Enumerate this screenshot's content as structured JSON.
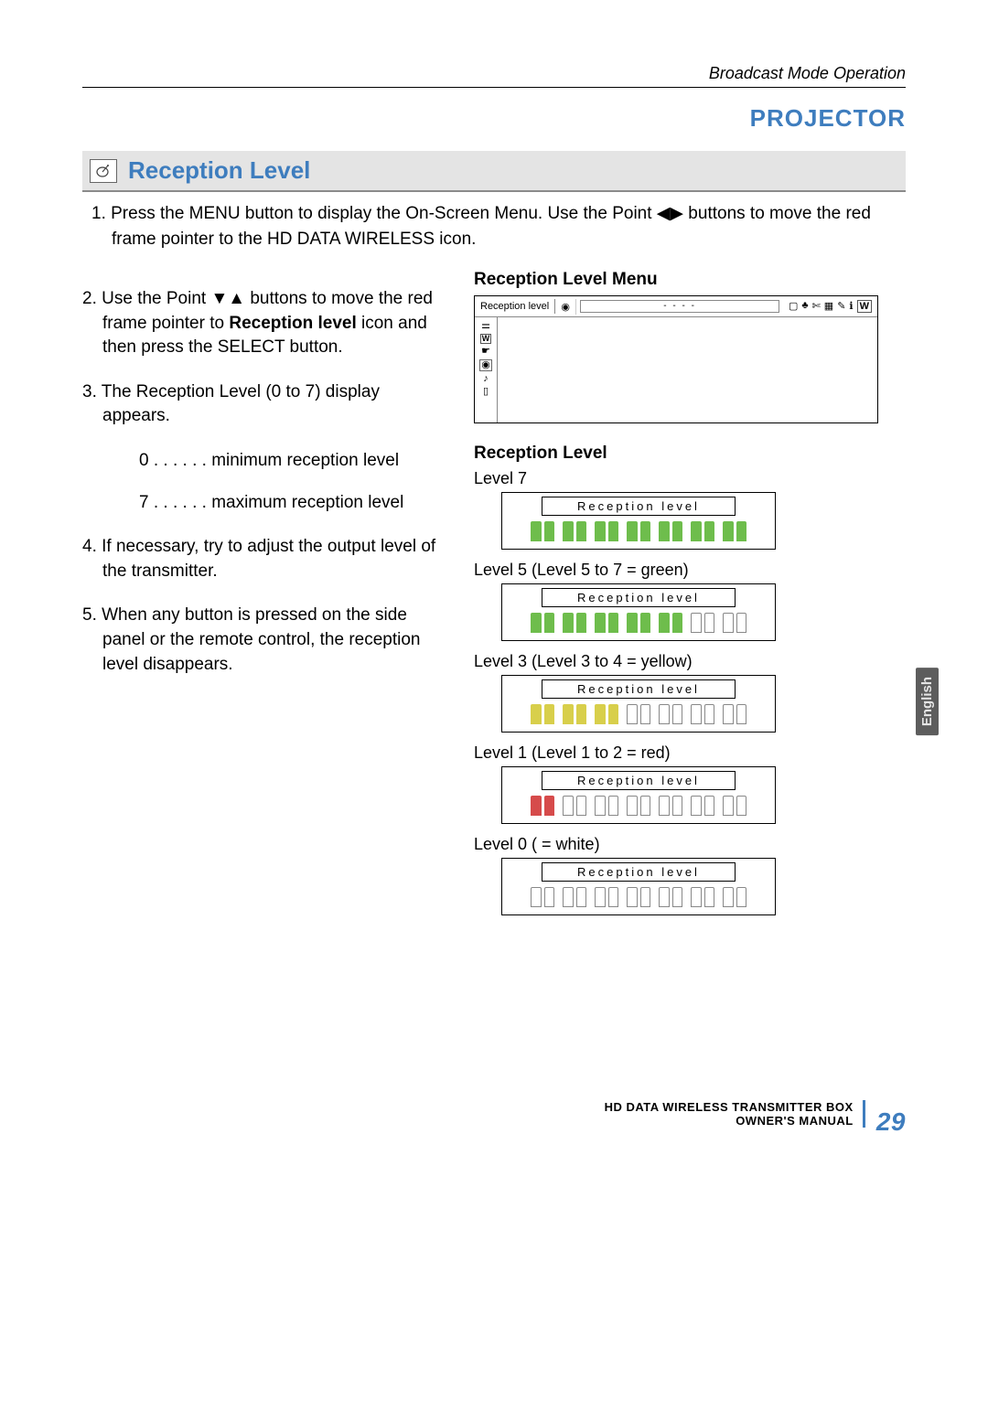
{
  "running_head": "Broadcast Mode Operation",
  "projector": "PROJECTOR",
  "section_title": "Reception Level",
  "intro_step": "1.  Press the MENU button to display the On-Screen Menu. Use the Point ◀▶ buttons to move the red frame pointer to the HD DATA WIRELESS icon.",
  "steps": {
    "s2a": "2. Use the Point ▼▲ buttons to move the red frame pointer to ",
    "s2b": "Reception level",
    "s2c": " icon and then press the SELECT button.",
    "s3": "3. The Reception Level (0 to 7) display appears.",
    "s3_0": "0 . . . . . . minimum reception level",
    "s3_7": "7 . . . . . . maximum reception level",
    "s4": "4. If necessary, try to adjust the output level of the transmitter.",
    "s5": "5. When any button is pressed on the side panel or the remote control, the reception level disappears."
  },
  "right": {
    "menu_heading": "Reception Level Menu",
    "menu_label": "Reception level",
    "reception_heading": "Reception Level",
    "box_title": "Reception  level",
    "l7": "Level 7",
    "l5": "Level 5    (Level 5 to 7 = green)",
    "l3": "Level 3    (Level 3 to 4 = yellow)",
    "l1": "Level 1    (Level 1 to 2 = red)",
    "l0": "Level 0    ( = white)"
  },
  "side_tab": "English",
  "footer": {
    "line1": "HD DATA WIRELESS TRANSMITTER BOX",
    "line2": "OWNER'S MANUAL",
    "page": "29"
  },
  "chart_data": [
    {
      "type": "bar",
      "title": "Reception level",
      "level": 7,
      "segments_filled": 14,
      "total_segments": 14,
      "color": "green",
      "range_note": "Level 5 to 7 = green"
    },
    {
      "type": "bar",
      "title": "Reception level",
      "level": 5,
      "segments_filled": 10,
      "total_segments": 14,
      "color": "green",
      "range_note": "Level 5 to 7 = green"
    },
    {
      "type": "bar",
      "title": "Reception level",
      "level": 3,
      "segments_filled": 6,
      "total_segments": 14,
      "color": "yellow",
      "range_note": "Level 3 to 4 = yellow"
    },
    {
      "type": "bar",
      "title": "Reception level",
      "level": 1,
      "segments_filled": 2,
      "total_segments": 14,
      "color": "red",
      "range_note": "Level 1 to 2 = red"
    },
    {
      "type": "bar",
      "title": "Reception level",
      "level": 0,
      "segments_filled": 0,
      "total_segments": 14,
      "color": "white",
      "range_note": "= white"
    }
  ]
}
